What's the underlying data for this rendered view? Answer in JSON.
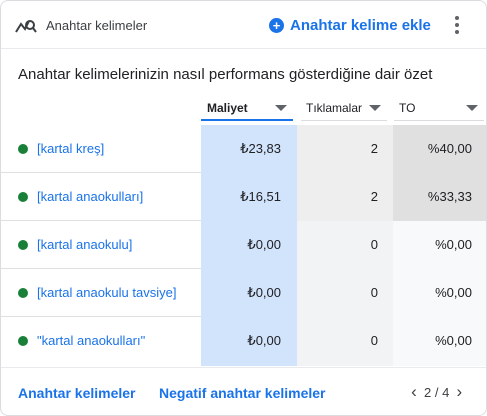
{
  "header": {
    "icon": "keyword-search-icon",
    "title": "Anahtar kelimeler",
    "add_label": "Anahtar kelime ekle",
    "menu_icon": "more-vert-icon"
  },
  "subtitle": "Anahtar kelimelerinizin nasıl performans gösterdiğine dair özet",
  "columns": {
    "cost": "Maliyet",
    "clicks": "Tıklamalar",
    "to": "TO"
  },
  "rows": [
    {
      "keyword": "[kartal kreş]",
      "cost": "₺23,83",
      "clicks": "2",
      "to": "%40,00",
      "status_color": "#188038"
    },
    {
      "keyword": "[kartal anaokulları]",
      "cost": "₺16,51",
      "clicks": "2",
      "to": "%33,33",
      "status_color": "#188038"
    },
    {
      "keyword": "[kartal anaokulu]",
      "cost": "₺0,00",
      "clicks": "0",
      "to": "%0,00",
      "status_color": "#188038"
    },
    {
      "keyword": "[kartal anaokulu tavsiye]",
      "cost": "₺0,00",
      "clicks": "0",
      "to": "%0,00",
      "status_color": "#188038"
    },
    {
      "keyword": "\"kartal anaokulları\"",
      "cost": "₺0,00",
      "clicks": "0",
      "to": "%0,00",
      "status_color": "#188038"
    }
  ],
  "footer": {
    "link_keywords": "Anahtar kelimeler",
    "link_negative": "Negatif anahtar kelimeler",
    "page_indicator": "2 / 4",
    "prev_icon": "chevron-left-icon",
    "next_icon": "chevron-right-icon"
  },
  "colors": {
    "accent": "#1a73e8",
    "status_enabled": "#188038",
    "selected_column": "#d2e3fc"
  }
}
